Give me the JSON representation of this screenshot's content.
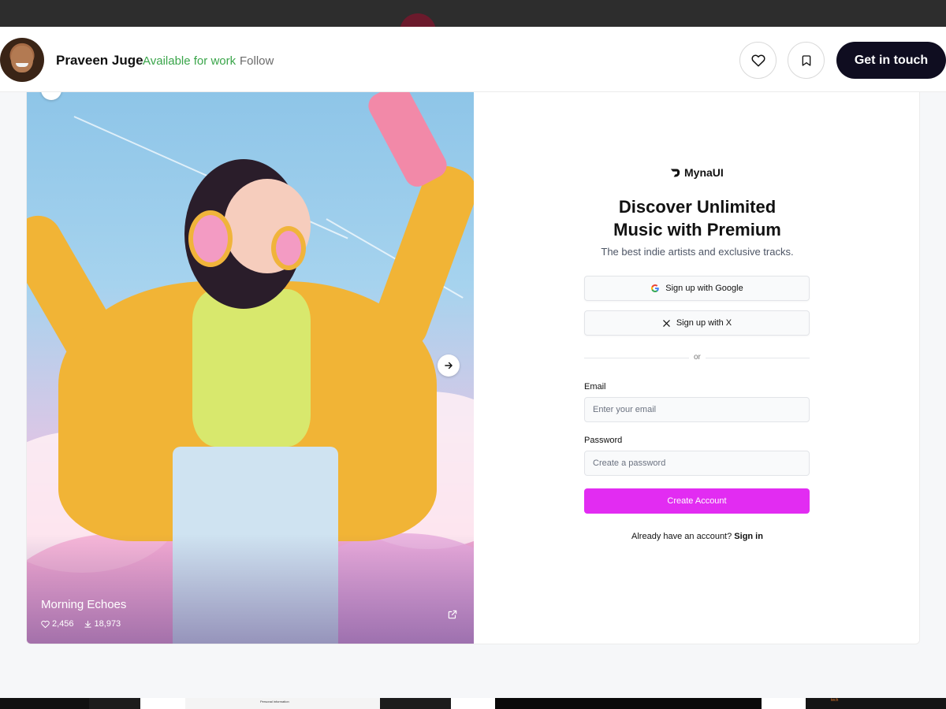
{
  "header": {
    "author_name": "Praveen Juge",
    "availability": "Available for work",
    "follow_label": "Follow",
    "cta_label": "Get in touch"
  },
  "shot": {
    "title": "Morning Echoes",
    "likes": "2,456",
    "downloads": "18,973"
  },
  "signup": {
    "brand": "MynaUI",
    "headline_line1": "Discover Unlimited",
    "headline_line2": "Music with Premium",
    "subheadline": "The best indie artists and exclusive tracks.",
    "google_button": "Sign up with Google",
    "x_button": "Sign up with X",
    "divider": "or",
    "email_label": "Email",
    "email_placeholder": "Enter your email",
    "password_label": "Password",
    "password_placeholder": "Create a password",
    "submit_label": "Create Account",
    "signin_prompt": "Already have an account?",
    "signin_link": "Sign in"
  },
  "bottom_strip": {
    "caption": "Personal information",
    "badge": "tech"
  },
  "colors": {
    "accent": "#e22cf2",
    "cta_bg": "#0f0d20",
    "available_green": "#3aa54a"
  }
}
